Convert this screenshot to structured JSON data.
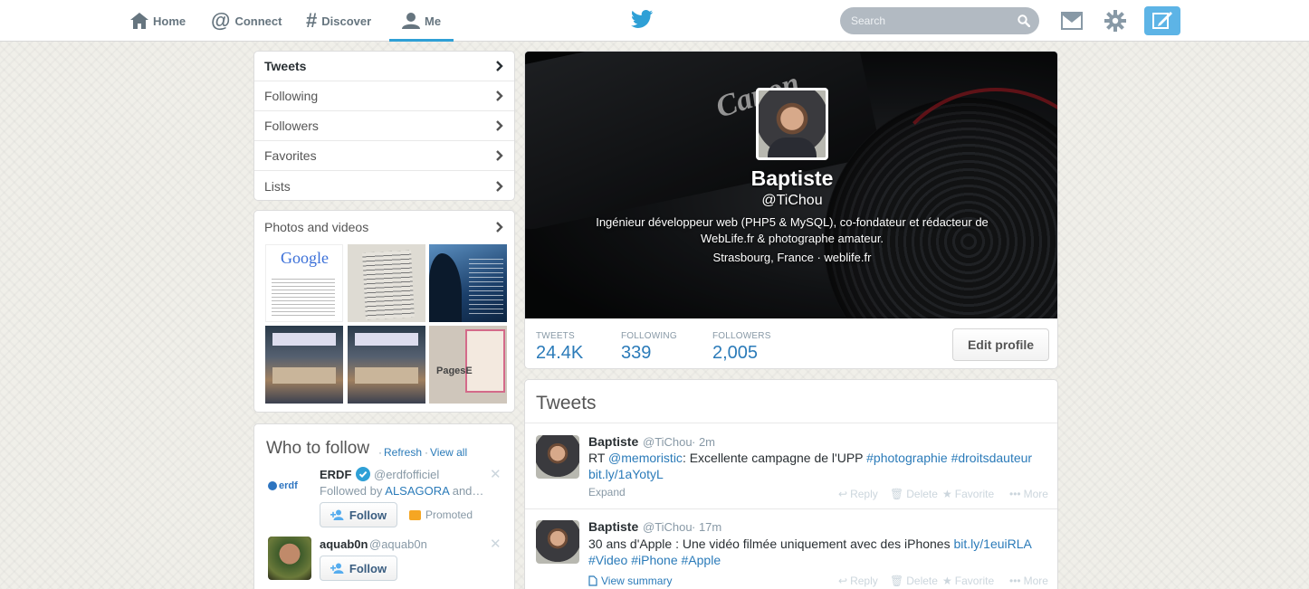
{
  "nav": {
    "home": "Home",
    "connect": "Connect",
    "discover": "Discover",
    "me": "Me",
    "search_placeholder": "Search"
  },
  "menu": {
    "items": [
      {
        "label": "Tweets",
        "active": true
      },
      {
        "label": "Following",
        "active": false
      },
      {
        "label": "Followers",
        "active": false
      },
      {
        "label": "Favorites",
        "active": false
      },
      {
        "label": "Lists",
        "active": false
      }
    ]
  },
  "photos": {
    "title": "Photos and videos",
    "thumbnails": [
      {
        "kind": "google-screenshot",
        "logo_text": "Google"
      },
      {
        "kind": "handwritten-note"
      },
      {
        "kind": "poster"
      },
      {
        "kind": "meeting-photo"
      },
      {
        "kind": "meeting-photo"
      },
      {
        "kind": "pagesjaunes-leaflet",
        "text": "PagesE"
      }
    ]
  },
  "who_to_follow": {
    "title": "Who to follow",
    "refresh": "Refresh",
    "view_all": "View all",
    "separator": "·",
    "accounts": [
      {
        "name": "ERDF",
        "handle": "@erdfofficiel",
        "verified": true,
        "followed_by_prefix": "Followed by",
        "followed_by_user": "ALSAGORA",
        "followed_by_suffix": "and…",
        "follow_label": "Follow",
        "promoted_label": "Promoted",
        "logo_text": "erdf"
      },
      {
        "name": "aquab0n",
        "handle": "@aquab0n",
        "follow_label": "Follow"
      }
    ]
  },
  "profile": {
    "name": "Baptiste",
    "handle": "@TiChou",
    "bio": "Ingénieur développeur web (PHP5 & MySQL), co-fondateur et rédacteur de WebLife.fr & photographe amateur.",
    "location": "Strasbourg, France",
    "separator": "·",
    "website": "weblife.fr",
    "stats": [
      {
        "label": "TWEETS",
        "value": "24.4K"
      },
      {
        "label": "FOLLOWING",
        "value": "339"
      },
      {
        "label": "FOLLOWERS",
        "value": "2,005"
      }
    ],
    "edit_label": "Edit profile",
    "banner_text": "Canon"
  },
  "tweets": {
    "title": "Tweets",
    "actions": {
      "reply": "Reply",
      "delete": "Delete",
      "favorite": "Favorite",
      "more": "More"
    },
    "items": [
      {
        "name": "Baptiste",
        "handle": "@TiChou",
        "time": "· 2m",
        "line1_parts": [
          {
            "t": "RT ",
            "link": false
          },
          {
            "t": "@memoristic",
            "link": true
          },
          {
            "t": ": Excellente campagne de l'UPP ",
            "link": false
          },
          {
            "t": "#photographie",
            "link": true
          },
          {
            "t": " ",
            "link": false
          },
          {
            "t": "#droitsdauteur",
            "link": true
          }
        ],
        "line2_parts": [
          {
            "t": "bit.ly/1aYotyL",
            "link": true
          }
        ],
        "footer": "Expand"
      },
      {
        "name": "Baptiste",
        "handle": "@TiChou",
        "time": "· 17m",
        "line1_parts": [
          {
            "t": "30 ans d'Apple : Une vidéo filmée uniquement avec des iPhones ",
            "link": false
          },
          {
            "t": "bit.ly/1euiRLA",
            "link": true
          }
        ],
        "line2_parts": [
          {
            "t": "#Video",
            "link": true
          },
          {
            "t": " ",
            "link": false
          },
          {
            "t": "#iPhone",
            "link": true
          },
          {
            "t": " ",
            "link": false
          },
          {
            "t": "#Apple",
            "link": true
          }
        ],
        "footer": "View summary"
      }
    ]
  },
  "colors": {
    "accent": "#2fa0d6",
    "link": "#2b7bb9",
    "compose": "#5db4e6",
    "search_bg": "#b2bac2"
  }
}
